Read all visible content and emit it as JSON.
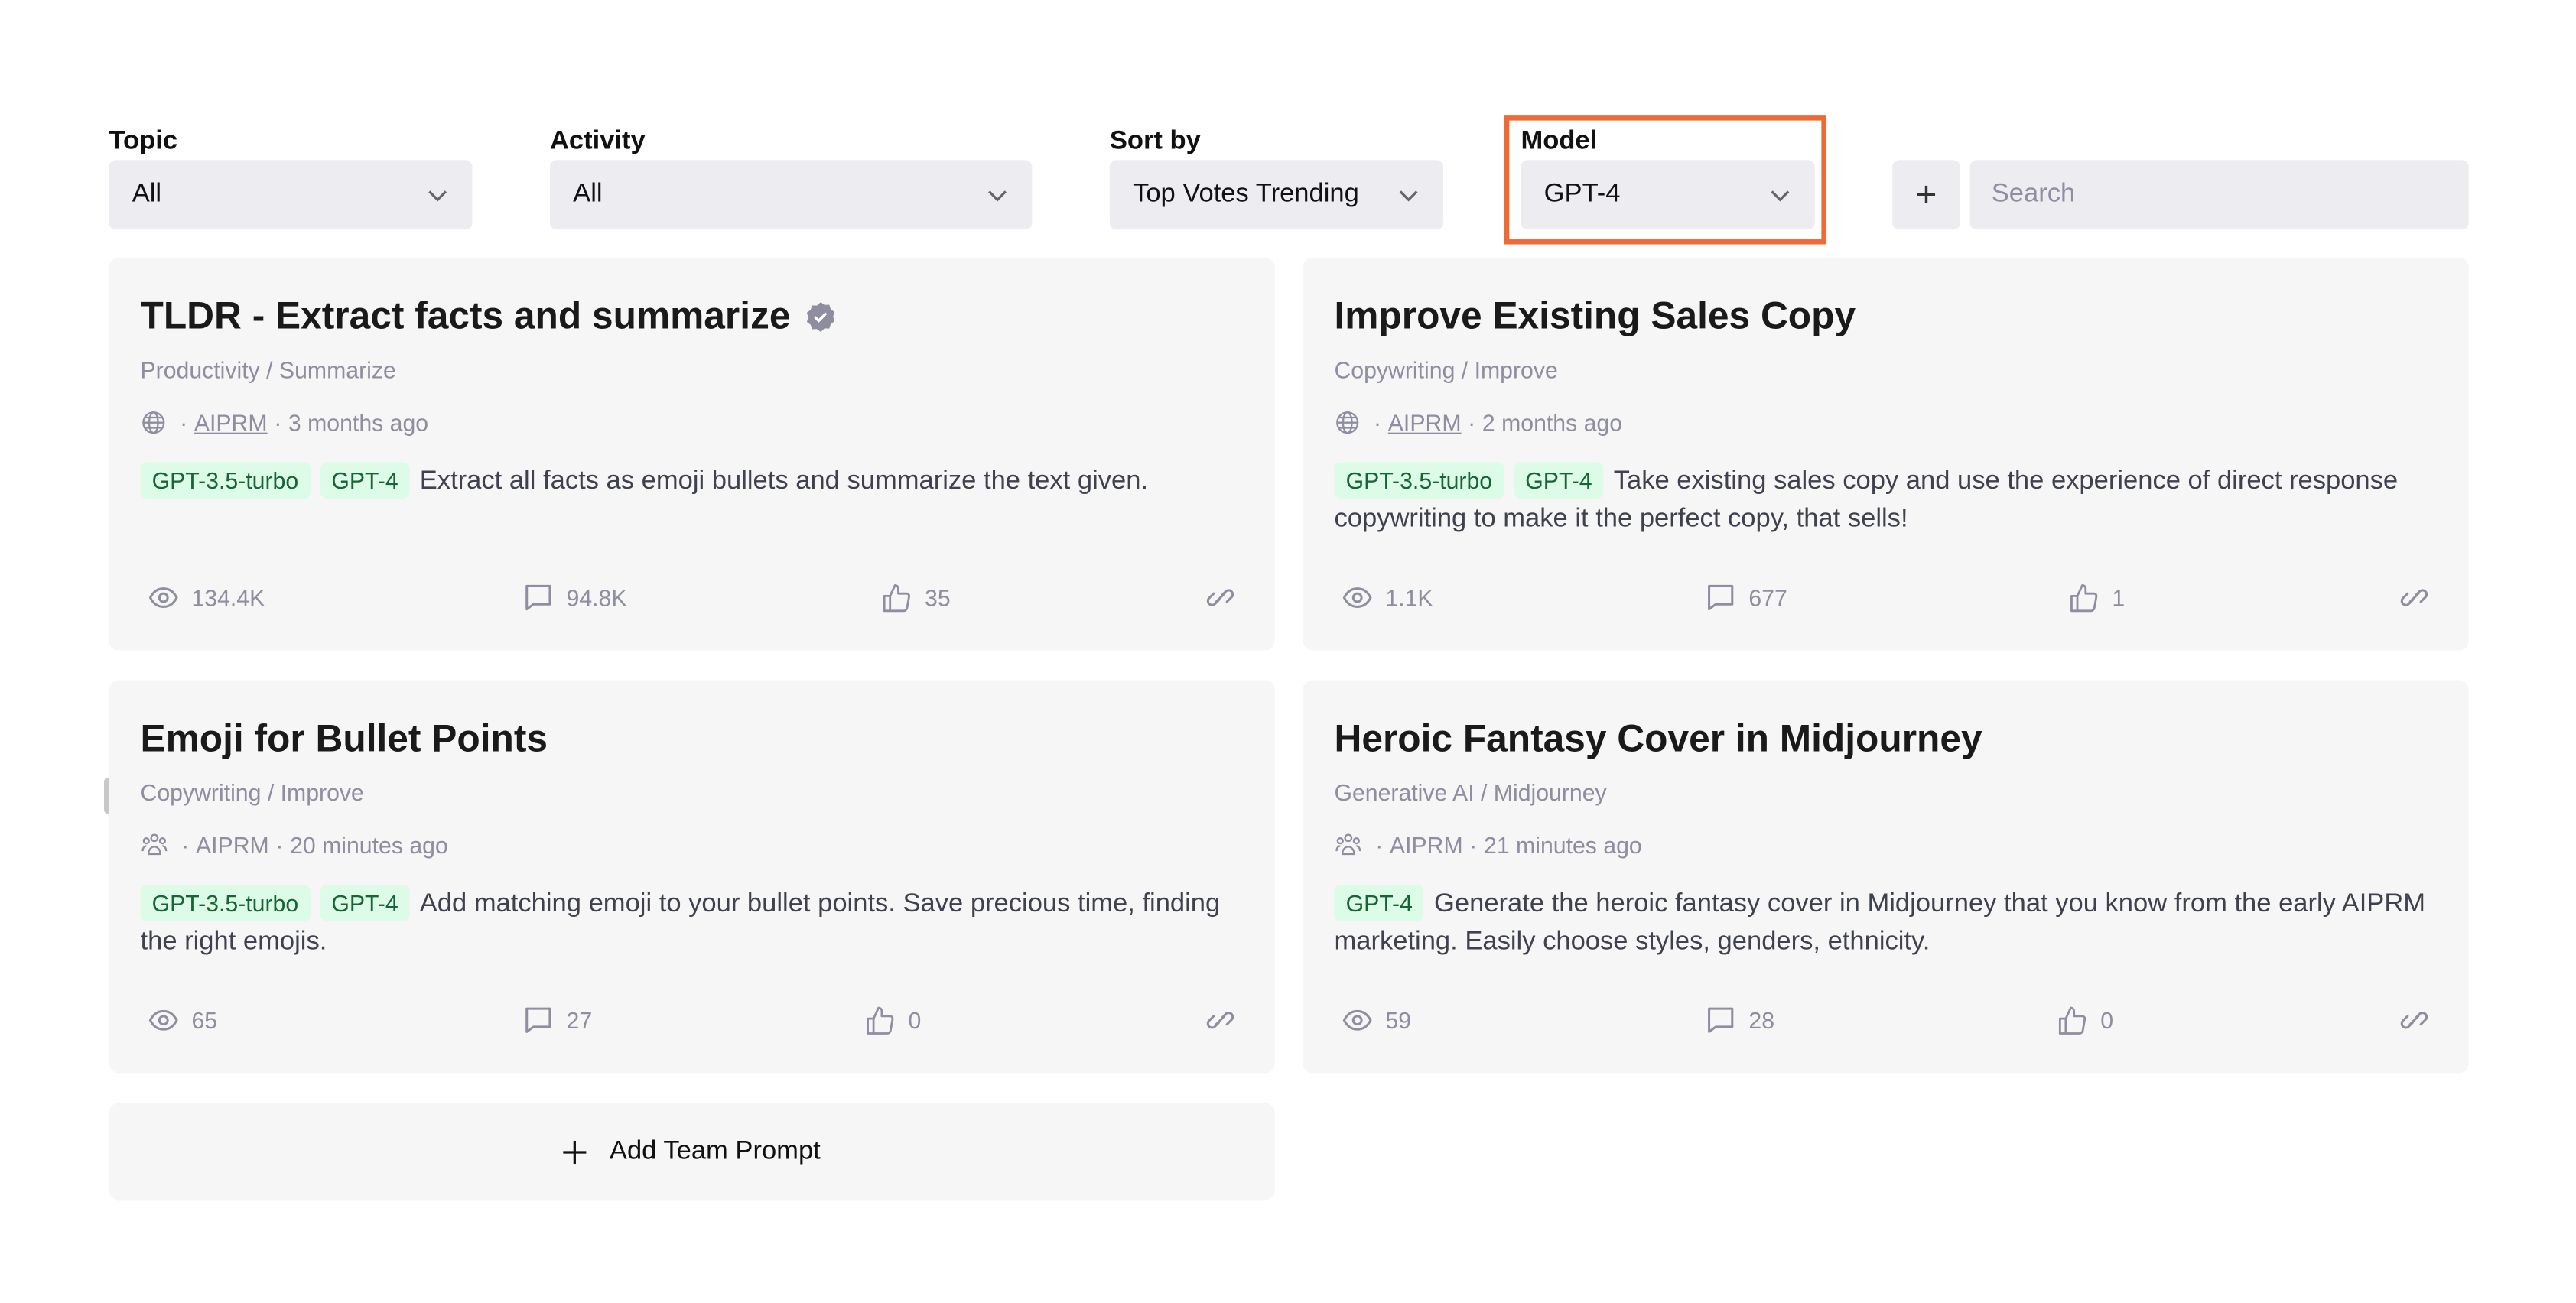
{
  "filters": {
    "topic": {
      "label": "Topic",
      "value": "All"
    },
    "activity": {
      "label": "Activity",
      "value": "All"
    },
    "sort": {
      "label": "Sort by",
      "value": "Top Votes Trending"
    },
    "model": {
      "label": "Model",
      "value": "GPT-4"
    },
    "add_label": "+",
    "search_placeholder": "Search"
  },
  "highlight_color": "#ee6b35",
  "cards": [
    {
      "title": "TLDR - Extract facts and summarize",
      "verified": true,
      "category": "Productivity / Summarize",
      "visibility_icon": "globe-icon",
      "author": "AIPRM",
      "time": "3 months ago",
      "tags": [
        "GPT-3.5-turbo",
        "GPT-4"
      ],
      "description": "Extract all facts as emoji bullets and summarize the text given.",
      "views": "134.4K",
      "comments": "94.8K",
      "votes": "35"
    },
    {
      "title": "Improve Existing Sales Copy",
      "category": "Copywriting / Improve",
      "visibility_icon": "globe-icon",
      "author": "AIPRM",
      "time": "2 months ago",
      "tags": [
        "GPT-3.5-turbo",
        "GPT-4"
      ],
      "description": "Take existing sales copy and use the experience of direct response copywriting to make it the perfect copy, that sells!",
      "views": "1.1K",
      "comments": "677",
      "votes": "1"
    },
    {
      "title": "Emoji for Bullet Points",
      "category": "Copywriting / Improve",
      "visibility_icon": "team-icon",
      "author": "AIPRM",
      "time": "20 minutes ago",
      "tags": [
        "GPT-3.5-turbo",
        "GPT-4"
      ],
      "description": "Add matching emoji to your bullet points. Save precious time, finding the right emojis.",
      "views": "65",
      "comments": "27",
      "votes": "0"
    },
    {
      "title": "Heroic Fantasy Cover in Midjourney",
      "category": "Generative AI / Midjourney",
      "visibility_icon": "team-icon",
      "author": "AIPRM",
      "time": "21 minutes ago",
      "tags": [
        "GPT-4"
      ],
      "description": "Generate the heroic fantasy cover in Midjourney that you know from the early AIPRM marketing. Easily choose styles, genders, ethnicity.",
      "views": "59",
      "comments": "28",
      "votes": "0"
    }
  ],
  "add_team_prompt": "Add Team Prompt"
}
